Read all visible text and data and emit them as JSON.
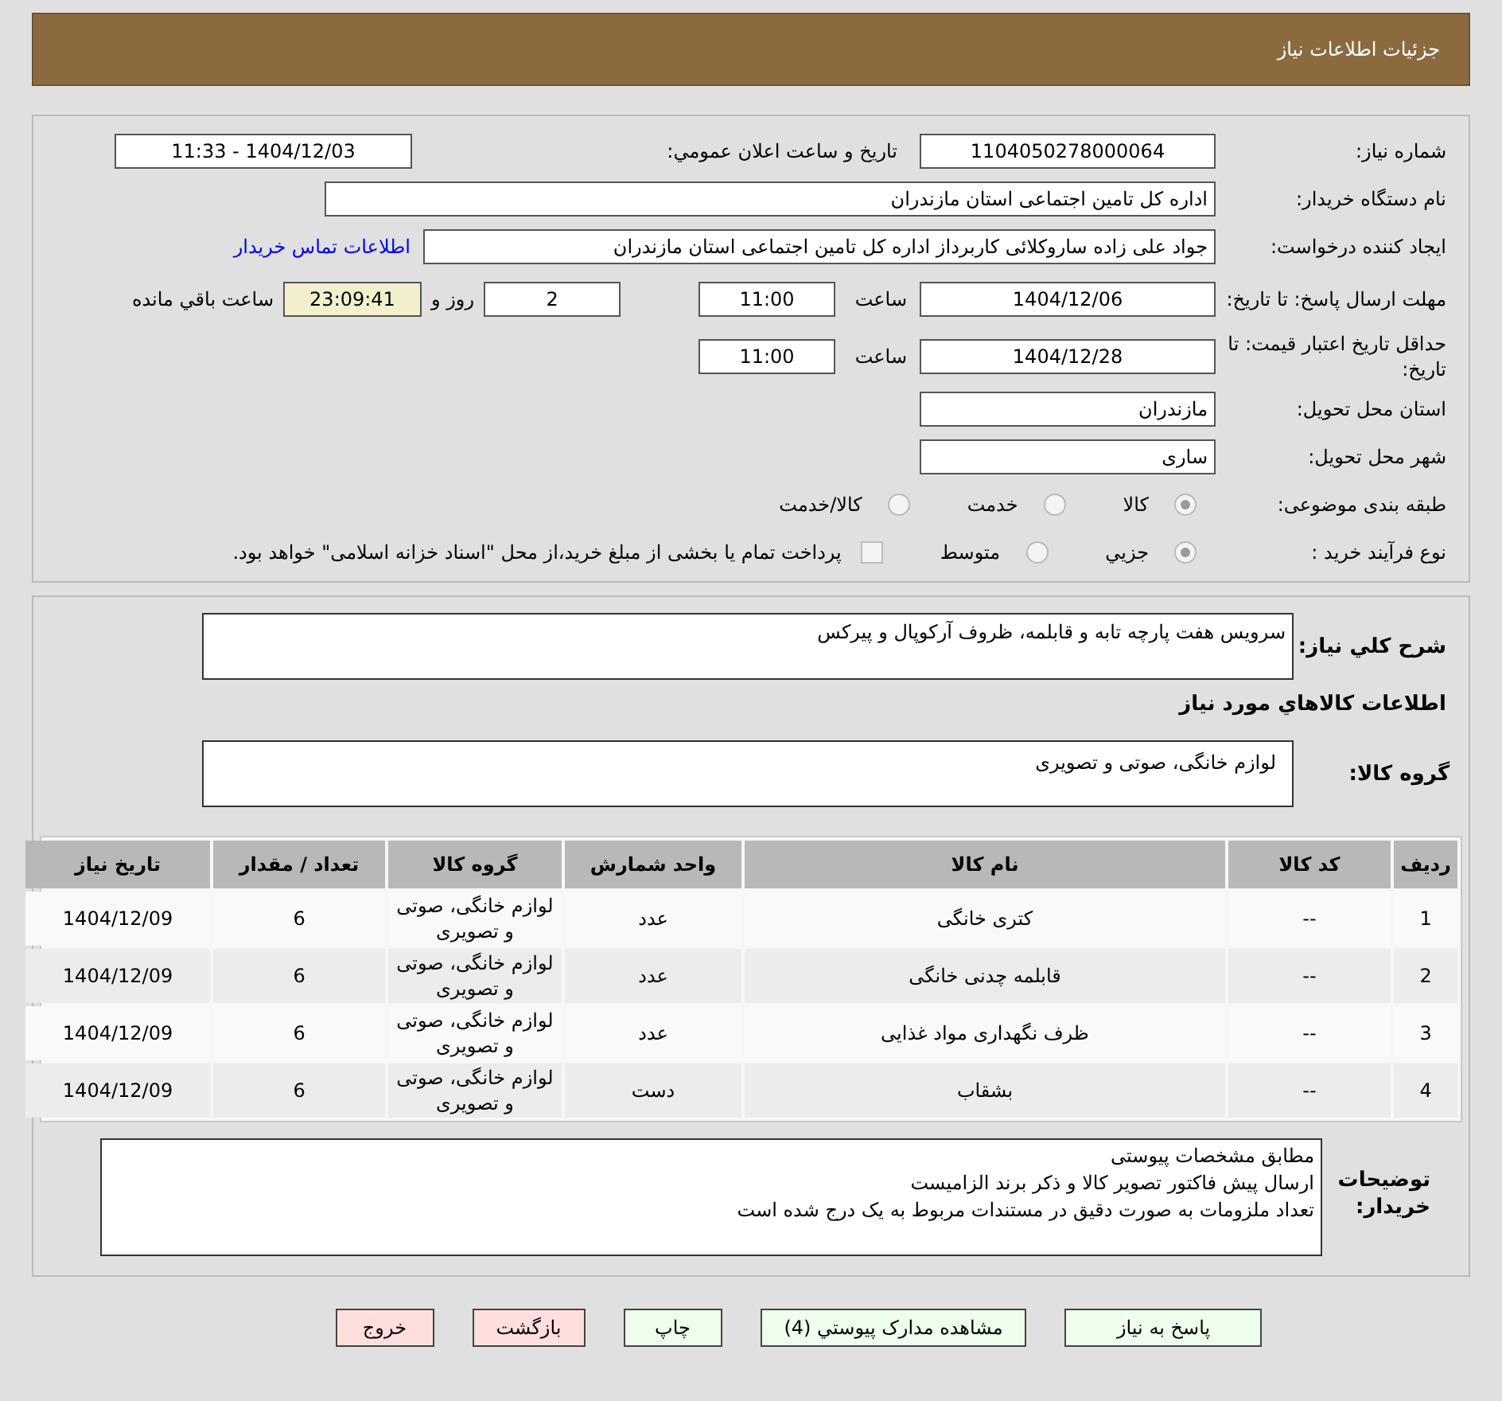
{
  "header": {
    "title": "جزئیات اطلاعات نیاز"
  },
  "details": {
    "need_number": {
      "label": "شماره نیاز:",
      "value": "1104050278000064"
    },
    "announce": {
      "label": "تاریخ و ساعت اعلان عمومي:",
      "value": "1404/12/03 - 11:33"
    },
    "buyer": {
      "label": "نام دستگاه خریدار:",
      "value": "اداره کل تامین اجتماعی استان مازندران"
    },
    "creator": {
      "label": "ایجاد کننده درخواست:",
      "value": "جواد علی زاده ساروکلائی کاربرداز اداره کل تامین اجتماعی استان مازندران",
      "link": "اطلاعات تماس خریدار"
    },
    "reply_deadline": {
      "label": "مهلت ارسال پاسخ: تا تاریخ:",
      "date": "1404/12/06",
      "time_label": "ساعت",
      "time": "11:00",
      "days": "2",
      "days_label": "روز و",
      "remaining": "23:09:41",
      "remaining_label": "ساعت باقي مانده"
    },
    "price_validity": {
      "label": "حداقل تاریخ اعتبار قیمت: تا تاریخ:",
      "date": "1404/12/28",
      "time_label": "ساعت",
      "time": "11:00"
    },
    "province": {
      "label": "استان محل تحویل:",
      "value": "مازندران"
    },
    "city": {
      "label": "شهر محل تحویل:",
      "value": "ساری"
    },
    "category": {
      "label": "طبقه بندی موضوعی:",
      "options": [
        {
          "label": "کالا",
          "selected": true
        },
        {
          "label": "خدمت",
          "selected": false
        },
        {
          "label": "کالا/خدمت",
          "selected": false
        }
      ]
    },
    "process": {
      "label": "نوع فرآیند خرید :",
      "options": [
        {
          "label": "جزيي",
          "selected": true
        },
        {
          "label": "متوسط",
          "selected": false
        }
      ],
      "payment": {
        "label": "پرداخت تمام یا بخشی از مبلغ خرید،از محل \"اسناد خزانه اسلامی\" خواهد بود.",
        "checked": false
      }
    }
  },
  "summary": {
    "label": "شرح کلي نیاز:",
    "value": "سرویس هفت پارچه تابه و قابلمه، ظروف آرکوپال و پیرکس"
  },
  "items_heading": "اطلاعات کالاهاي مورد نیاز",
  "goods_group": {
    "label": "گروه کالا:",
    "value": "لوازم خانگی، صوتی و تصویری"
  },
  "table": {
    "columns": [
      "ردیف",
      "کد کالا",
      "نام کالا",
      "واحد شمارش",
      "گروه کالا",
      "تعداد / مقدار",
      "تاریخ نیاز"
    ],
    "rows": [
      [
        "1",
        "--",
        "کتری خانگی",
        "عدد",
        "لوازم خانگی، صوتی و تصویری",
        "6",
        "1404/12/09"
      ],
      [
        "2",
        "--",
        "قابلمه چدنی خانگی",
        "عدد",
        "لوازم خانگی، صوتی و تصویری",
        "6",
        "1404/12/09"
      ],
      [
        "3",
        "--",
        "ظرف نگهداری مواد غذایی",
        "عدد",
        "لوازم خانگی، صوتی و تصویری",
        "6",
        "1404/12/09"
      ],
      [
        "4",
        "--",
        "بشقاب",
        "دست",
        "لوازم خانگی، صوتی و تصویری",
        "6",
        "1404/12/09"
      ]
    ]
  },
  "buyer_notes": {
    "label": "توضیحات خریدار:",
    "value": "مطابق مشخصات پیوستی\nارسال پیش فاکتور تصویر کالا و ذکر برند الزامیست\nتعداد ملزومات به صورت دقیق در مستندات مربوط به یک درج شده است"
  },
  "buttons": [
    {
      "label": "پاسخ به نیاز",
      "kind": "action"
    },
    {
      "label": "مشاهده مدارک پیوستي (4)",
      "kind": "action"
    },
    {
      "label": "چاپ",
      "kind": "action"
    },
    {
      "label": "بازگشت",
      "kind": "nav"
    },
    {
      "label": "خروج",
      "kind": "nav"
    }
  ]
}
